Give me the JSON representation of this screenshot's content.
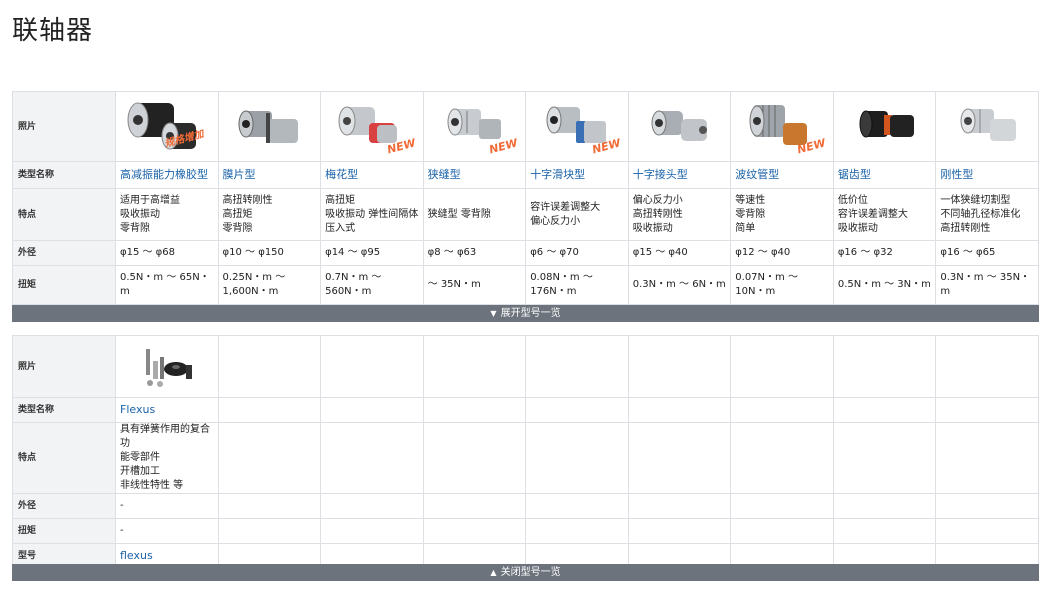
{
  "page": {
    "title": "联轴器"
  },
  "row_labels": {
    "photo": "照片",
    "type": "类型名称",
    "feature": "特点",
    "diameter": "外径",
    "torque": "扭矩",
    "model": "型号"
  },
  "badges": {
    "new": "NEW",
    "volume_up": "规格增加"
  },
  "colors": {
    "link": "#1a62a8",
    "badge": "#f06a35",
    "bar": "#6d737c",
    "header_bg": "#f2f3f5"
  },
  "products": [
    {
      "name": "高减振能力橡胶型",
      "features": [
        "适用于高增益",
        "吸收振动",
        "零背隙"
      ],
      "diameter": "φ15 ～ φ68",
      "torque": "0.5N・m ～ 65N・m",
      "icon": "rubber-coupling-icon"
    },
    {
      "name": "膜片型",
      "features": [
        "高扭转刚性",
        "高扭矩",
        "零背隙"
      ],
      "diameter": "φ10 ～ φ150",
      "torque": "0.25N・m ～ 1,600N・m",
      "icon": "disc-coupling-icon"
    },
    {
      "name": "梅花型",
      "features": [
        "高扭矩",
        "吸收振动 弹性间隔体",
        "压入式"
      ],
      "diameter": "φ14 ～ φ95",
      "torque": "0.7N・m ～ 560N・m",
      "icon": "jaw-coupling-icon"
    },
    {
      "name": "狭缝型",
      "features": [
        "狭缝型 零背隙"
      ],
      "diameter": "φ8 ～ φ63",
      "torque": "～ 35N・m",
      "icon": "slit-coupling-icon"
    },
    {
      "name": "十字滑块型",
      "features": [
        "容许误差调整大",
        "偏心反力小"
      ],
      "diameter": "φ6 ～ φ70",
      "torque": "0.08N・m ～ 176N・m",
      "icon": "oldham-coupling-icon"
    },
    {
      "name": "十字接头型",
      "features": [
        "偏心反力小",
        "高扭转刚性",
        "吸收振动"
      ],
      "diameter": "φ15 ～ φ40",
      "torque": "0.3N・m ～ 6N・m",
      "icon": "cross-coupling-icon"
    },
    {
      "name": "波纹管型",
      "features": [
        "等速性",
        "零背隙",
        "简单"
      ],
      "diameter": "φ12 ～ φ40",
      "torque": "0.07N・m ～ 10N・m",
      "icon": "bellows-coupling-icon"
    },
    {
      "name": "锯齿型",
      "features": [
        "低价位",
        "容许误差调整大",
        "吸收振动"
      ],
      "diameter": "φ16 ～ φ32",
      "torque": "0.5N・m ～ 3N・m",
      "icon": "gear-coupling-icon"
    },
    {
      "name": "刚性型",
      "features": [
        "一体狭缝切割型",
        "不同轴孔径标准化",
        "高扭转刚性"
      ],
      "diameter": "φ16 ～ φ65",
      "torque": "0.3N・m ～ 35N・m",
      "icon": "rigid-coupling-icon"
    }
  ],
  "extra_products": [
    {
      "name": "Flexus",
      "features": [
        "具有弹簧作用的复合功",
        "能零部件",
        "开槽加工",
        "非线性特性 等"
      ],
      "diameter": "-",
      "torque": "-",
      "model": "flexus",
      "icon": "flexus-parts-icon"
    }
  ],
  "buttons": {
    "expand": "展开型号一览",
    "collapse": "关闭型号一览"
  }
}
